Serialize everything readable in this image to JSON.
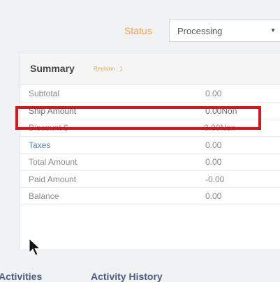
{
  "status": {
    "label": "Status",
    "value": "Processing"
  },
  "summary": {
    "title": "Summary",
    "revision": "Revision : 1",
    "rows": [
      {
        "label": "Subtotal",
        "value": "0.00"
      },
      {
        "label": "Ship Amount",
        "value": "0.00Non"
      },
      {
        "label": "Discount $",
        "value": "-0.00Non"
      },
      {
        "label": "Taxes",
        "value": "0.00"
      },
      {
        "label": "Total Amount",
        "value": "0.00"
      },
      {
        "label": "Paid Amount",
        "value": "-0.00"
      },
      {
        "label": "Balance",
        "value": "0.00"
      }
    ]
  },
  "tabs": [
    "Activities",
    "Activity History"
  ],
  "colors": {
    "accent": "#e6a15a",
    "highlight": "#d1181d",
    "link": "#5b7bb0"
  }
}
